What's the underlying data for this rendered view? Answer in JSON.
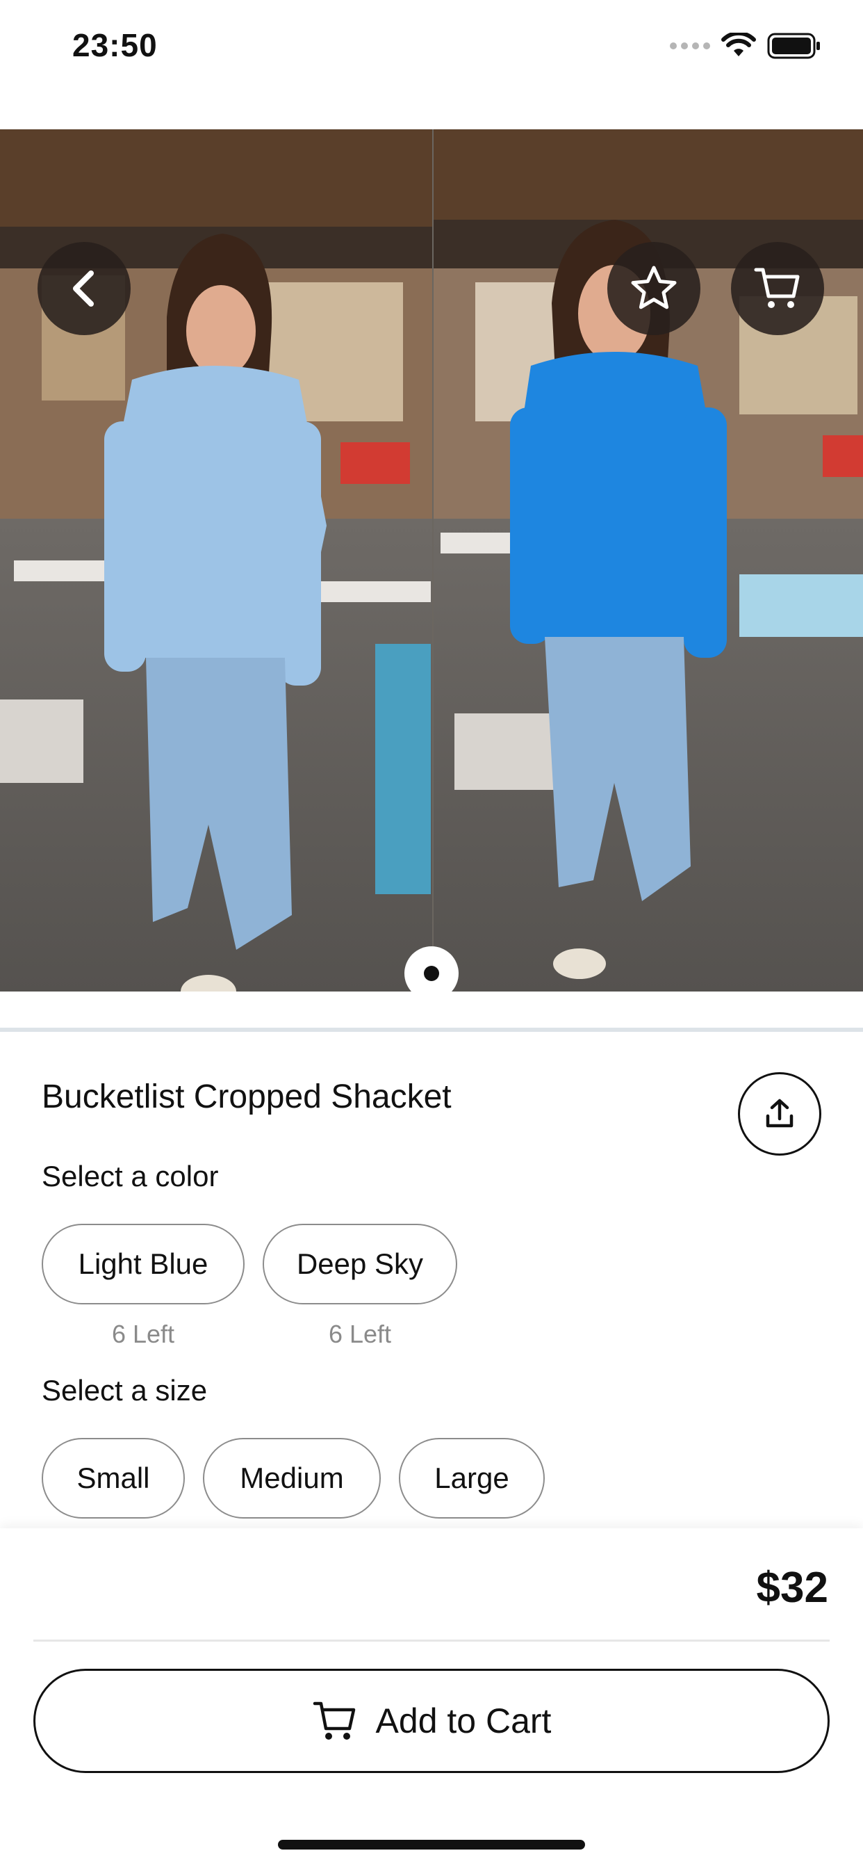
{
  "status_bar": {
    "time": "23:50",
    "icons": [
      "cellular-signal-icon",
      "wifi-icon",
      "battery-icon"
    ]
  },
  "hero": {
    "icons": {
      "back": "chevron-left-icon",
      "favorite": "star-icon",
      "cart": "cart-icon"
    },
    "page_count": 1,
    "current_page": 1
  },
  "product": {
    "title": "Bucketlist Cropped Shacket",
    "share_icon": "share-icon"
  },
  "color_section": {
    "label": "Select a color",
    "options": [
      {
        "label": "Light Blue",
        "stock": "6 Left"
      },
      {
        "label": "Deep Sky",
        "stock": "6 Left"
      }
    ]
  },
  "size_section": {
    "label": "Select a size",
    "options": [
      "Small",
      "Medium",
      "Large"
    ]
  },
  "checkout": {
    "price": "$32",
    "add_to_cart_label": "Add to Cart",
    "add_to_cart_icon": "cart-icon"
  },
  "colors": {
    "text": "#111111",
    "muted": "#8a8a8a",
    "pill_border": "#8c8c8c",
    "overlay_button": "#28201c",
    "light_blue_top": "#9dc3e6",
    "deep_sky_top": "#1e86e0",
    "denim": "#8fb3d6"
  }
}
